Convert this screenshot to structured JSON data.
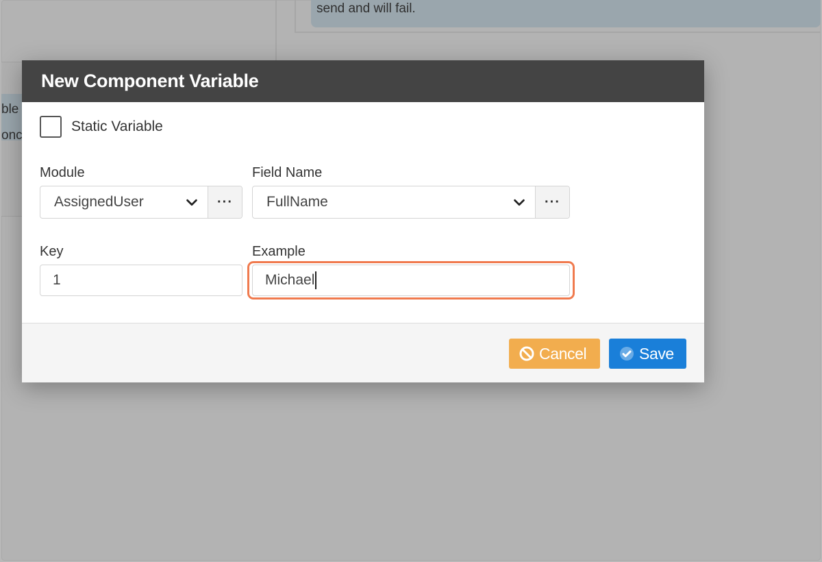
{
  "background": {
    "alert_text": "send and will fail.",
    "left_fragments": [
      "ble",
      "onc"
    ]
  },
  "modal": {
    "title": "New Component Variable",
    "static_checkbox": {
      "label": "Static Variable",
      "checked": false
    },
    "module": {
      "label": "Module",
      "value": "AssignedUser",
      "more_label": "···"
    },
    "field_name": {
      "label": "Field Name",
      "value": "FullName",
      "more_label": "···"
    },
    "key": {
      "label": "Key",
      "value": "1"
    },
    "example": {
      "label": "Example",
      "value": "Michael"
    },
    "footer": {
      "cancel_label": "Cancel",
      "save_label": "Save"
    }
  },
  "colors": {
    "header_bg": "#444444",
    "cancel": "#f2ad4e",
    "save": "#1a7fd9",
    "focus_highlight": "#f07a4e"
  }
}
